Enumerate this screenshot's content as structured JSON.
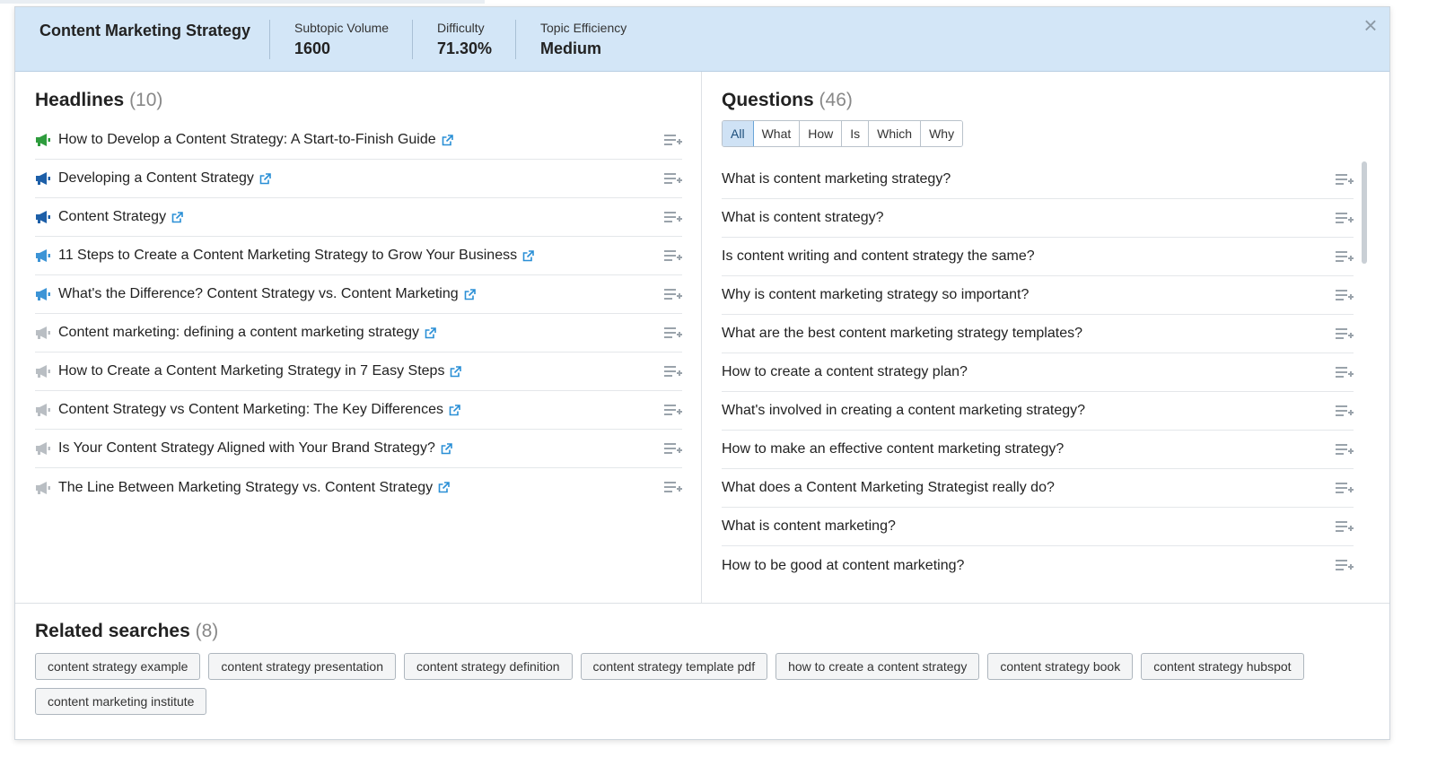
{
  "header": {
    "topic": "Content Marketing Strategy",
    "metrics": [
      {
        "label": "Subtopic Volume",
        "value": "1600"
      },
      {
        "label": "Difficulty",
        "value": "71.30%"
      },
      {
        "label": "Topic Efficiency",
        "value": "Medium"
      }
    ],
    "close_glyph": "×"
  },
  "headlines": {
    "title": "Headlines",
    "count": "(10)",
    "items": [
      {
        "text": "How to Develop a Content Strategy: A Start-to-Finish Guide",
        "icon_color": "#2e9c3d"
      },
      {
        "text": "Developing a Content Strategy",
        "icon_color": "#1d5fa8"
      },
      {
        "text": "Content Strategy",
        "icon_color": "#1d5fa8"
      },
      {
        "text": "11 Steps to Create a Content Marketing Strategy to Grow Your Business",
        "icon_color": "#3c94d6"
      },
      {
        "text": "What's the Difference? Content Strategy vs. Content Marketing",
        "icon_color": "#3c94d6"
      },
      {
        "text": "Content marketing: defining a content marketing strategy",
        "icon_color": "#b9bec3"
      },
      {
        "text": "How to Create a Content Marketing Strategy in 7 Easy Steps",
        "icon_color": "#b9bec3"
      },
      {
        "text": "Content Strategy vs Content Marketing: The Key Differences",
        "icon_color": "#b9bec3"
      },
      {
        "text": "Is Your Content Strategy Aligned with Your Brand Strategy?",
        "icon_color": "#b9bec3"
      },
      {
        "text": "The Line Between Marketing Strategy vs. Content Strategy",
        "icon_color": "#b9bec3"
      }
    ]
  },
  "questions": {
    "title": "Questions",
    "count": "(46)",
    "filters": [
      "All",
      "What",
      "How",
      "Is",
      "Which",
      "Why"
    ],
    "active_filter": "All",
    "items": [
      "What is content marketing strategy?",
      "What is content strategy?",
      "Is content writing and content strategy the same?",
      "Why is content marketing strategy so important?",
      "What are the best content marketing strategy templates?",
      "How to create a content strategy plan?",
      "What's involved in creating a content marketing strategy?",
      "How to make an effective content marketing strategy?",
      "What does a Content Marketing Strategist really do?",
      "What is content marketing?",
      "How to be good at content marketing?"
    ]
  },
  "related": {
    "title": "Related searches",
    "count": "(8)",
    "tags": [
      "content strategy example",
      "content strategy presentation",
      "content strategy definition",
      "content strategy template pdf",
      "how to create a content strategy",
      "content strategy book",
      "content strategy hubspot",
      "content marketing institute"
    ]
  },
  "colors": {
    "header_bg": "#d3e6f7",
    "link_blue": "#2a8fd6",
    "add_icon": "#9aa3ab"
  }
}
